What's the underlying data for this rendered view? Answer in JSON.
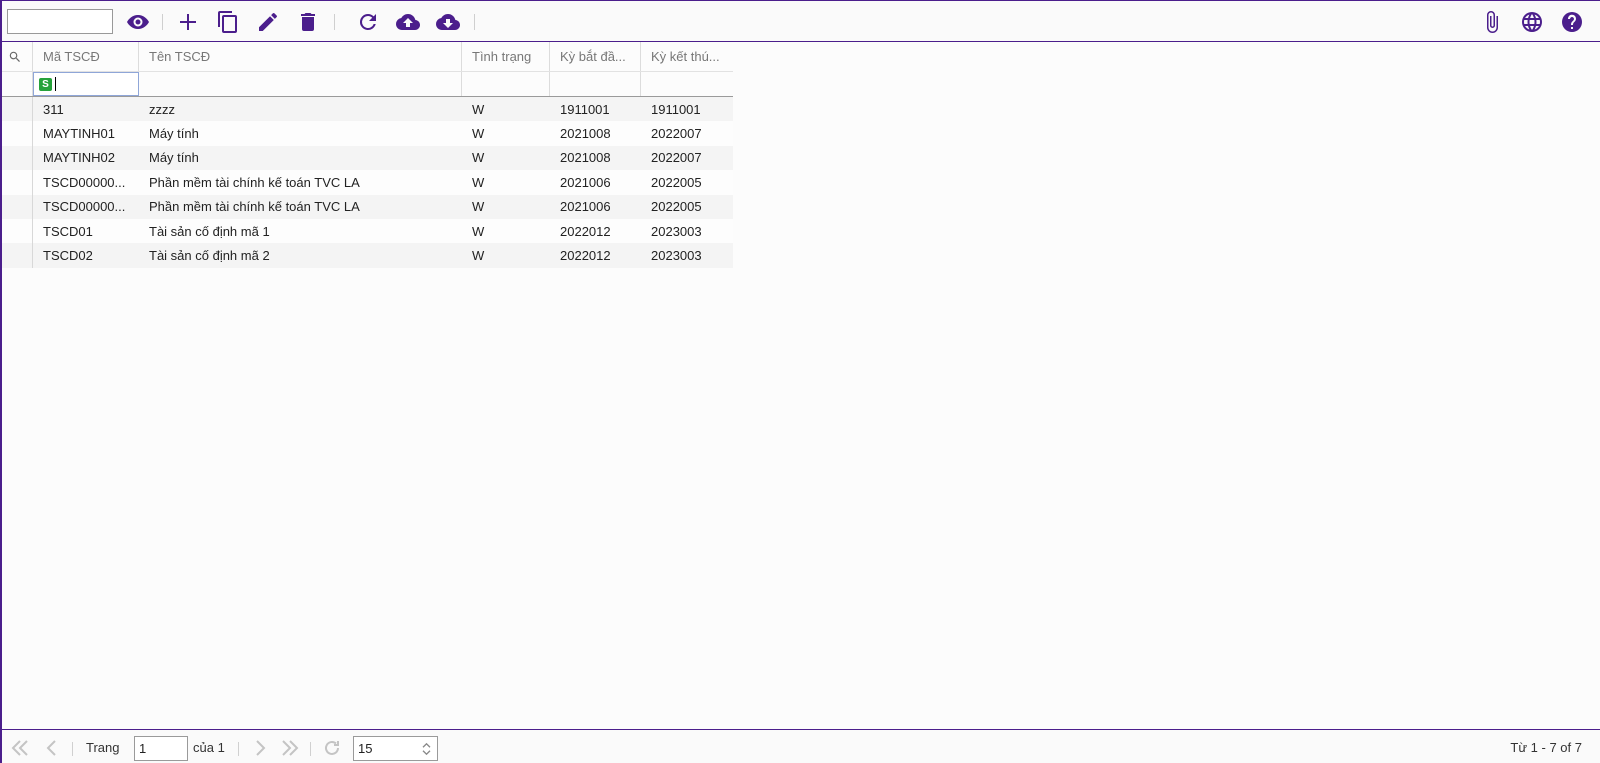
{
  "toolbar": {
    "search_value": "",
    "icons": [
      "eye-icon",
      "plus-icon",
      "copy-icon",
      "pencil-icon",
      "trash-icon",
      "refresh-icon",
      "cloud-upload-icon",
      "cloud-download-icon",
      "paperclip-icon",
      "globe-icon",
      "help-icon"
    ],
    "accent": "#4b1e8c"
  },
  "grid": {
    "columns": [
      {
        "label": "Mã TSCĐ"
      },
      {
        "label": "Tên TSCĐ"
      },
      {
        "label": "Tình trạng"
      },
      {
        "label": "Kỳ bắt đầ..."
      },
      {
        "label": "Kỳ kết thú..."
      }
    ],
    "filter_badge": "S",
    "rows": [
      {
        "ma": "311",
        "ten": "zzzz",
        "tinh_trang": "W",
        "ky_bat_dau": "1911001",
        "ky_ket_thuc": "1911001"
      },
      {
        "ma": "MAYTINH01",
        "ten": "Máy tính",
        "tinh_trang": "W",
        "ky_bat_dau": "2021008",
        "ky_ket_thuc": "2022007"
      },
      {
        "ma": "MAYTINH02",
        "ten": "Máy tính",
        "tinh_trang": "W",
        "ky_bat_dau": "2021008",
        "ky_ket_thuc": "2022007"
      },
      {
        "ma": "TSCD00000...",
        "ten": "Phần mềm tài chính kế toán TVC LA",
        "tinh_trang": "W",
        "ky_bat_dau": "2021006",
        "ky_ket_thuc": "2022005"
      },
      {
        "ma": "TSCD00000...",
        "ten": "Phần mềm tài chính kế toán TVC LA",
        "tinh_trang": "W",
        "ky_bat_dau": "2021006",
        "ky_ket_thuc": "2022005"
      },
      {
        "ma": "TSCD01",
        "ten": "Tài sản cố định mã 1",
        "tinh_trang": "W",
        "ky_bat_dau": "2022012",
        "ky_ket_thuc": "2023003"
      },
      {
        "ma": "TSCD02",
        "ten": "Tài sản cố định mã 2",
        "tinh_trang": "W",
        "ky_bat_dau": "2022012",
        "ky_ket_thuc": "2023003"
      }
    ]
  },
  "pager": {
    "page_label": "Trang",
    "page_value": "1",
    "of_label": "của 1",
    "page_size": "15",
    "summary": "Từ 1 - 7 of 7"
  }
}
